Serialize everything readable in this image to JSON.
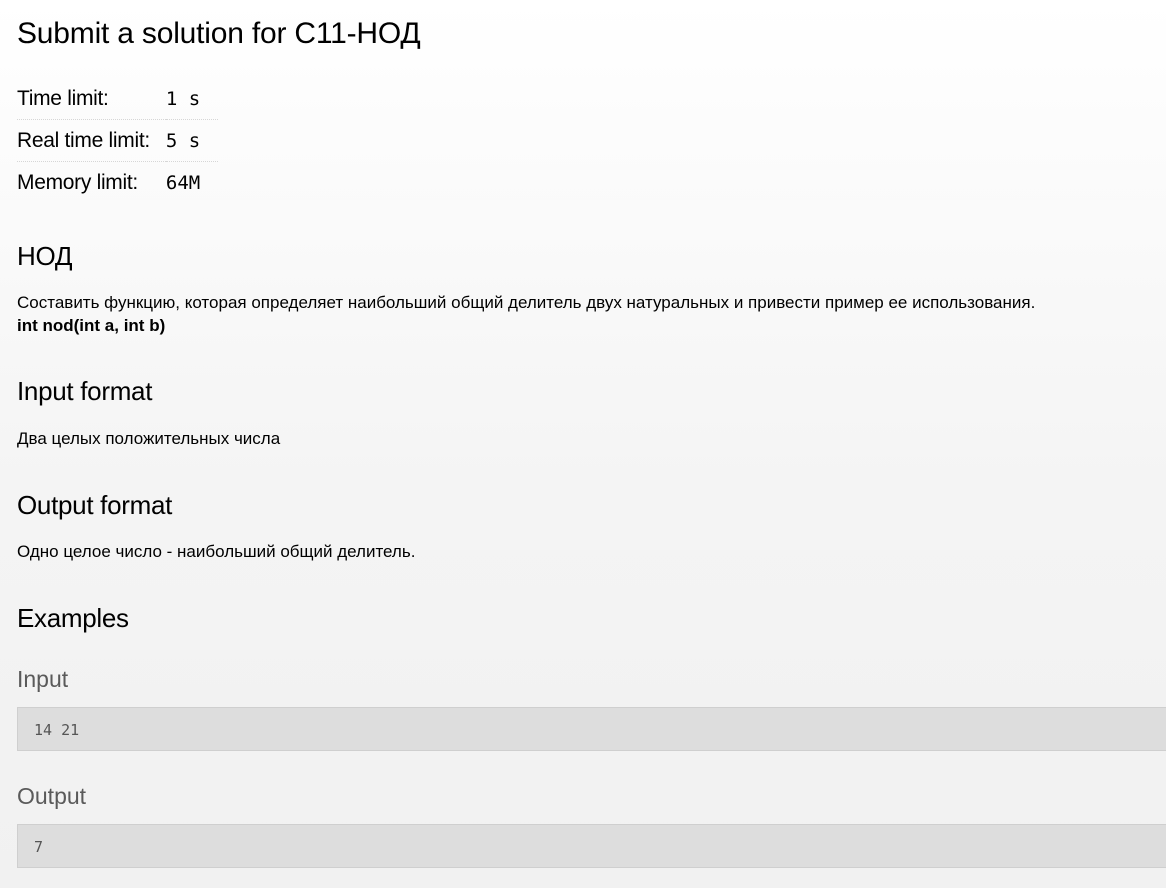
{
  "page_title": "Submit a solution for C11-НОД",
  "limits": [
    {
      "label": "Time limit:",
      "value": "1 s"
    },
    {
      "label": "Real time limit:",
      "value": "5 s"
    },
    {
      "label": "Memory limit:",
      "value": "64M"
    }
  ],
  "statement": {
    "title": "НОД",
    "text": "Составить функцию, которая определяет наибольший общий делитель двух натуральных и привести пример ее использования.",
    "signature": "int nod(int a, int b)"
  },
  "input_format": {
    "title": "Input format",
    "text": "Два целых положительных числа"
  },
  "output_format": {
    "title": "Output format",
    "text": "Одно целое число - наибольший общий делитель."
  },
  "examples": {
    "title": "Examples",
    "input_label": "Input",
    "input_value": "14 21",
    "output_label": "Output",
    "output_value": "7"
  }
}
